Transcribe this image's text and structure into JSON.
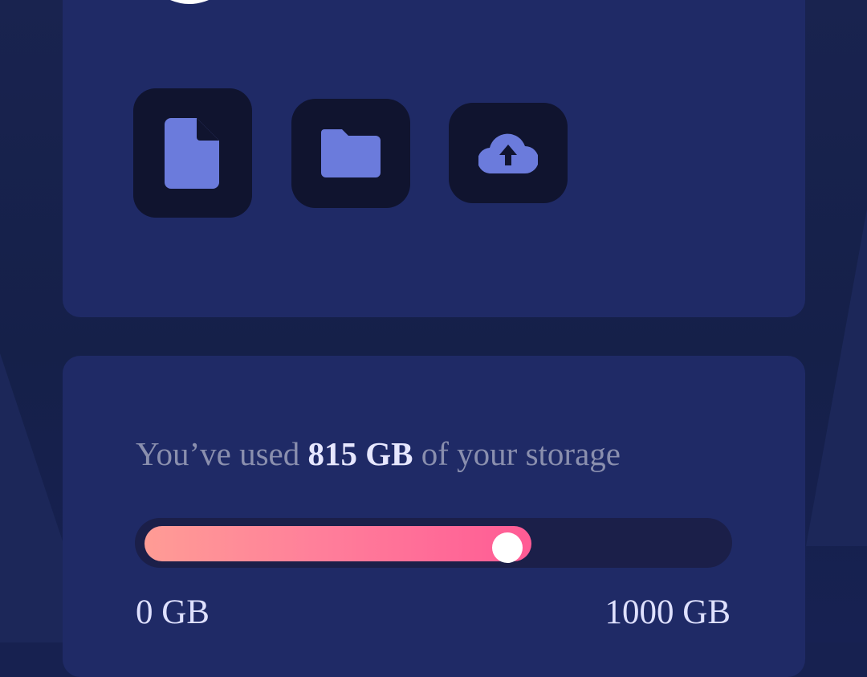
{
  "colors": {
    "background": "#172150",
    "card": "#1f2a66",
    "tile": "#10142f",
    "icon": "#6b7bdc",
    "fill_start": "#ff9c95",
    "fill_end": "#ff5b95",
    "knob": "#ffffff"
  },
  "toolbar": {
    "icons": [
      "document-icon",
      "folder-icon",
      "cloud-upload-icon"
    ]
  },
  "storage": {
    "prefix": "You’ve used ",
    "used": "815 GB",
    "suffix": " of your storage",
    "progress_fraction": 0.67,
    "min_label": "0 GB",
    "max_label": "1000 GB"
  }
}
